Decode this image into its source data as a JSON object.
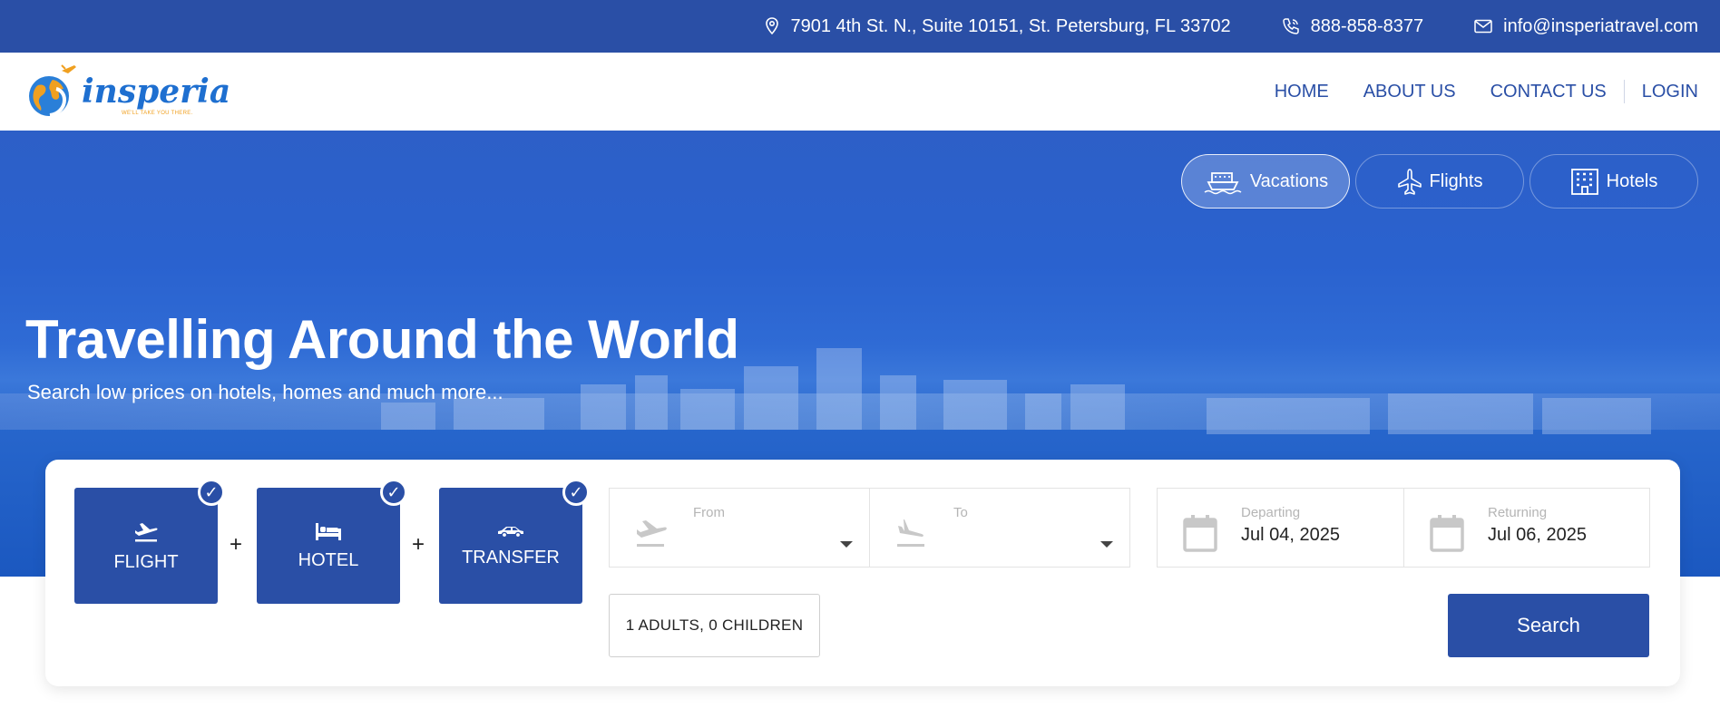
{
  "topbar": {
    "address": "7901 4th St. N., Suite 10151, St. Petersburg, FL 33702",
    "phone": "888-858-8377",
    "email": "info@insperiatravel.com"
  },
  "brand": {
    "name": "insperia",
    "tagline": "WE'LL TAKE YOU THERE."
  },
  "nav": {
    "items": [
      "HOME",
      "ABOUT US",
      "CONTACT US"
    ],
    "login": "LOGIN"
  },
  "tabs": [
    {
      "label": "Vacations",
      "icon": "ship-icon",
      "active": true
    },
    {
      "label": "Flights",
      "icon": "airplane-icon",
      "active": false
    },
    {
      "label": "Hotels",
      "icon": "hotel-building-icon",
      "active": false
    }
  ],
  "hero": {
    "title": "Travelling Around the World",
    "subtitle": "Search low prices on hotels, homes and much more..."
  },
  "packages": [
    {
      "label": "FLIGHT",
      "icon": "plane-departure-icon",
      "checked": true
    },
    {
      "label": "HOTEL",
      "icon": "bed-icon",
      "checked": true
    },
    {
      "label": "TRANSFER",
      "icon": "car-icon",
      "checked": true
    }
  ],
  "package_separator": "+",
  "check_glyph": "✓",
  "search_form": {
    "from": {
      "label": "From",
      "value": ""
    },
    "to": {
      "label": "To",
      "value": ""
    },
    "departing": {
      "label": "Departing",
      "value": "Jul 04, 2025"
    },
    "returning": {
      "label": "Returning",
      "value": "Jul 06, 2025"
    },
    "passengers": "1 ADULTS, 0 CHILDREN",
    "search_label": "Search"
  },
  "colors": {
    "primary": "#2a4fa6",
    "hero": "#2a62cf",
    "white": "#ffffff"
  }
}
